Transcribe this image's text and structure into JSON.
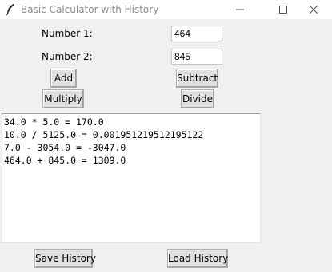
{
  "window": {
    "title": "Basic Calculator with History",
    "icon": "feather-icon",
    "controls": [
      "minimize-icon",
      "maximize-icon",
      "close-icon"
    ]
  },
  "inputs": {
    "number1": {
      "label": "Number 1:",
      "value": "464"
    },
    "number2": {
      "label": "Number 2:",
      "value": "845"
    }
  },
  "buttons": {
    "add": "Add",
    "subtract": "Subtract",
    "multiply": "Multiply",
    "divide": "Divide",
    "save_history": "Save History",
    "load_history": "Load History"
  },
  "history": [
    "34.0 * 5.0 = 170.0",
    "10.0 / 5125.0 = 0.001951219512195122",
    "7.0 - 3054.0 = -3047.0",
    "464.0 + 845.0 = 1309.0"
  ]
}
